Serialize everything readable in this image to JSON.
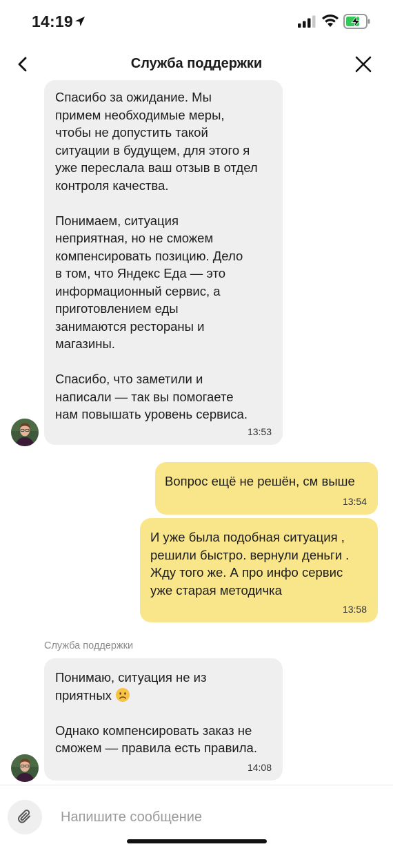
{
  "status_bar": {
    "time": "14:19",
    "icons": [
      "location-arrow-icon",
      "cellular-signal-icon",
      "wifi-icon",
      "battery-charging-icon"
    ]
  },
  "header": {
    "title": "Служба поддержки",
    "back_icon": "chevron-left-icon",
    "close_icon": "close-icon"
  },
  "messages": [
    {
      "direction": "incoming",
      "text": "Спасибо за ожидание. Мы\nпримем необходимые меры,\nчтобы не допустить такой\nситуации в будущем, для этого я\nуже переслала ваш отзыв в отдел\nконтроля качества.\n\nПонимаем, ситуация\nнеприятная, но не сможем\nкомпенсировать позицию. Дело\nв том, что Яндекс Еда — это\nинформационный сервис, а\nприготовлением еды\nзанимаются рестораны и\nмагазины.\n\nСпасибо, что заметили и\nнаписали — так вы помогаете\nнам повышать уровень сервиса.",
      "time": "13:53"
    },
    {
      "direction": "outgoing",
      "text": "Вопрос ещё не решён, см выше",
      "time": "13:54"
    },
    {
      "direction": "outgoing",
      "text": "И уже была подобная ситуация ,\nрешили быстро. вернули деньги .\nЖду того же. А про инфо сервис\nуже старая методичка",
      "time": "13:58"
    },
    {
      "direction": "incoming",
      "sender": "Служба поддержки",
      "text_line1": "Понимаю, ситуация не из",
      "text_line2": "приятных",
      "text_rest": "Однако компенсировать заказ не\nсможем — правила есть правила.",
      "emoji": "slightly-frowning-face-emoji",
      "time": "14:08"
    }
  ],
  "composer": {
    "placeholder": "Напишите сообщение",
    "attach_icon": "paperclip-icon"
  },
  "colors": {
    "incoming_bubble": "#efefef",
    "outgoing_bubble": "#f9e68a"
  }
}
